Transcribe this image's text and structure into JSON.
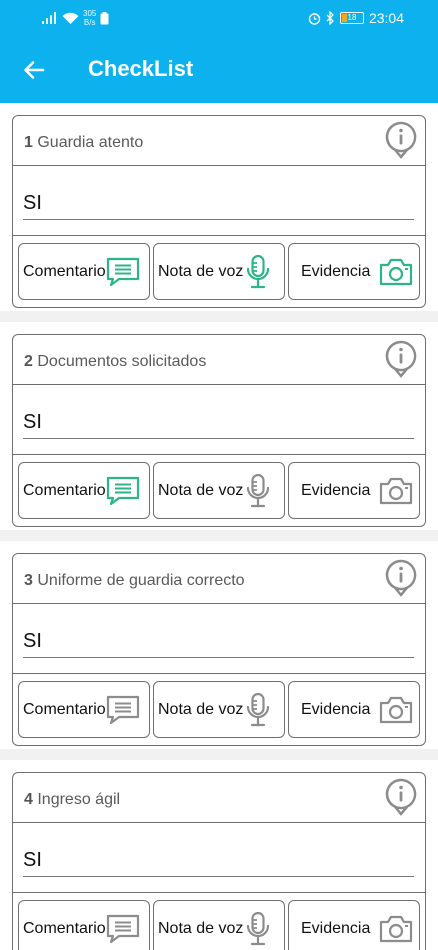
{
  "status_bar": {
    "network_speed": "305",
    "network_unit": "B/s",
    "battery_level": "18",
    "time": "23:04"
  },
  "app_bar": {
    "title": "CheckList"
  },
  "colors": {
    "primary": "#0cb1ee",
    "active_icon": "#2db58a",
    "inactive_icon": "#8c8c8c"
  },
  "items": [
    {
      "number": "1",
      "question": "Guardia atento",
      "answer": "SI",
      "comment_label": "Comentario",
      "voice_label": "Nota de voz",
      "evidence_label": "Evidencia",
      "comment_active": true,
      "voice_active": true,
      "evidence_active": true
    },
    {
      "number": "2",
      "question": "Documentos solicitados",
      "answer": "SI",
      "comment_label": "Comentario",
      "voice_label": "Nota de voz",
      "evidence_label": "Evidencia",
      "comment_active": true,
      "voice_active": false,
      "evidence_active": false
    },
    {
      "number": "3",
      "question": "Uniforme de guardia correcto",
      "answer": "SI",
      "comment_label": "Comentario",
      "voice_label": "Nota de voz",
      "evidence_label": "Evidencia",
      "comment_active": false,
      "voice_active": false,
      "evidence_active": false
    },
    {
      "number": "4",
      "question": "Ingreso ágil",
      "answer": "SI",
      "comment_label": "Comentario",
      "voice_label": "Nota de voz",
      "evidence_label": "Evidencia",
      "comment_active": false,
      "voice_active": false,
      "evidence_active": false
    }
  ]
}
